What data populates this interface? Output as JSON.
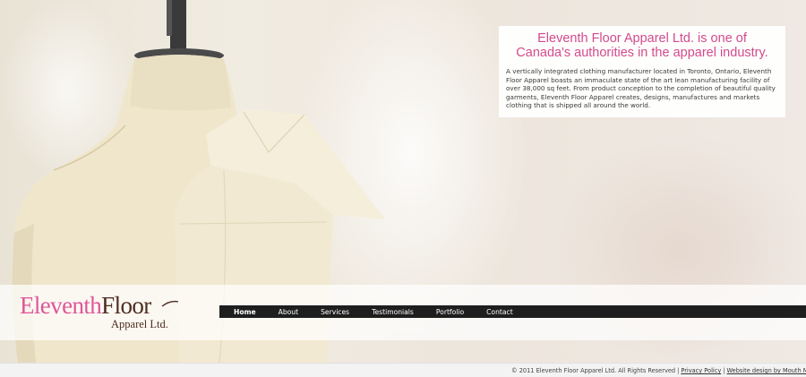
{
  "intro": {
    "brand": "Eleventh Floor Apparel Ltd.",
    "heading_rest_line1": " is one of",
    "heading_line2": "Canada's authorities in the apparel industry.",
    "body": "A vertically integrated clothing manufacturer located in Toronto, Ontario, Eleventh Floor Apparel boasts an immaculate state of the art lean manufacturing facility of over 38,000 sq feet. From product conception to the completion of beautiful quality garments, Eleventh Floor Apparel creates, designs, manufactures and markets clothing that is shipped all around the world."
  },
  "logo": {
    "eleventh": "Eleventh",
    "floor": "Floor",
    "sub": "Apparel Ltd."
  },
  "nav": {
    "items": [
      {
        "label": "Home"
      },
      {
        "label": "About"
      },
      {
        "label": "Services"
      },
      {
        "label": "Testimonials"
      },
      {
        "label": "Portfolio"
      },
      {
        "label": "Contact"
      }
    ]
  },
  "footer": {
    "copyright": "© 2011 Eleventh Floor Apparel Ltd. All Rights Reserved",
    "privacy": "Privacy Policy",
    "credit": "Website design by Mouth Media Inc"
  },
  "colors": {
    "brand_pink": "#d44a8c",
    "brand_brown": "#4d2d22",
    "nav_bar": "#1e1e1e"
  }
}
